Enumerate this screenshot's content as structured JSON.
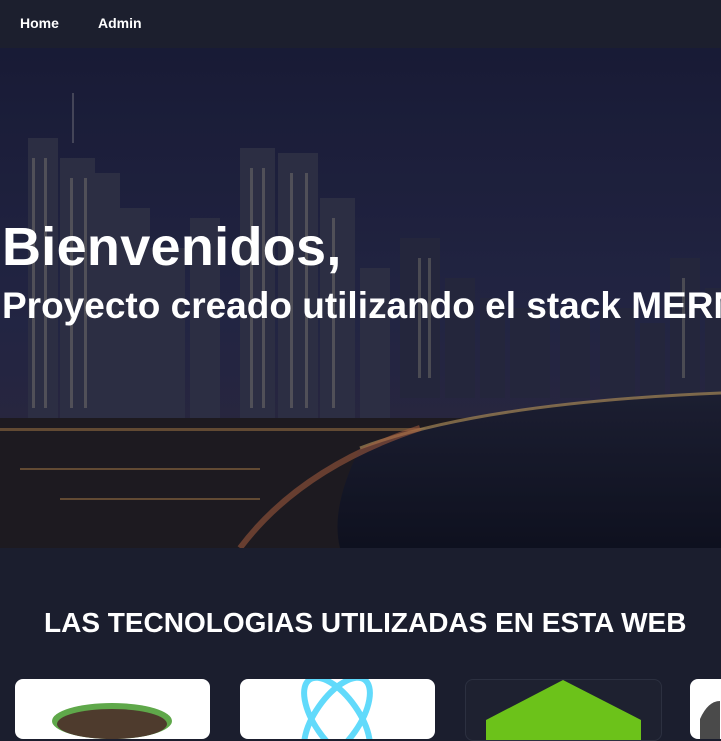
{
  "nav": {
    "home_label": "Home",
    "admin_label": "Admin"
  },
  "hero": {
    "title": "Bienvenidos,",
    "subtitle": "Proyecto creado utilizando el stack MERN"
  },
  "technologies": {
    "heading": "LAS TECNOLOGIAS UTILIZADAS EN ESTA WEB",
    "cards": [
      {
        "icon": "node-logo-icon"
      },
      {
        "icon": "react-logo-icon"
      },
      {
        "icon": "mongodb-logo-icon"
      },
      {
        "icon": "express-logo-icon"
      }
    ]
  },
  "colors": {
    "navbar": "#1c1f2e",
    "page_background": "#1b1e2e",
    "react": "#61dafb",
    "node": "#6cc24a",
    "mongodb": "#6cc24a"
  }
}
